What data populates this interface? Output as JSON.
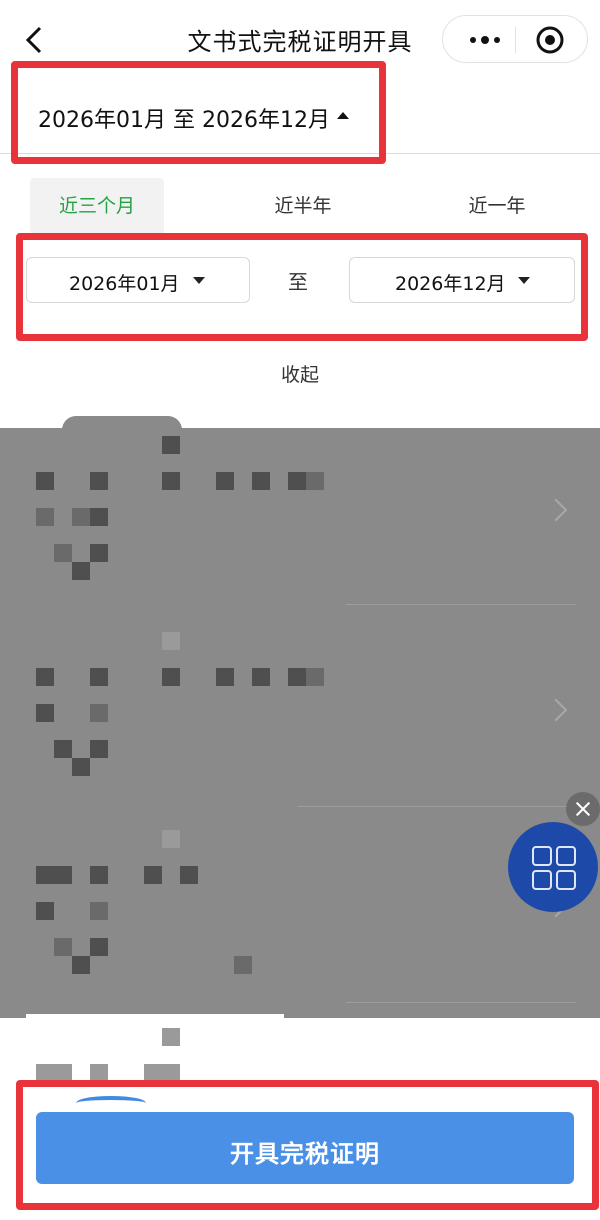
{
  "nav": {
    "title": "文书式完税证明开具"
  },
  "period": {
    "text": "2026年01月 至 2026年12月"
  },
  "tabs": [
    {
      "label": "近三个月",
      "active": true
    },
    {
      "label": "近半年"
    },
    {
      "label": "近一年"
    }
  ],
  "range": {
    "start": "2026年01月",
    "to_label": "至",
    "end": "2026年12月"
  },
  "collapse_label": "收起",
  "actions": {
    "issue_label": "开具完税证明"
  },
  "colors": {
    "accent_green": "#25a244",
    "primary_blue": "#4a90e7",
    "highlight_red": "#e8333a"
  }
}
